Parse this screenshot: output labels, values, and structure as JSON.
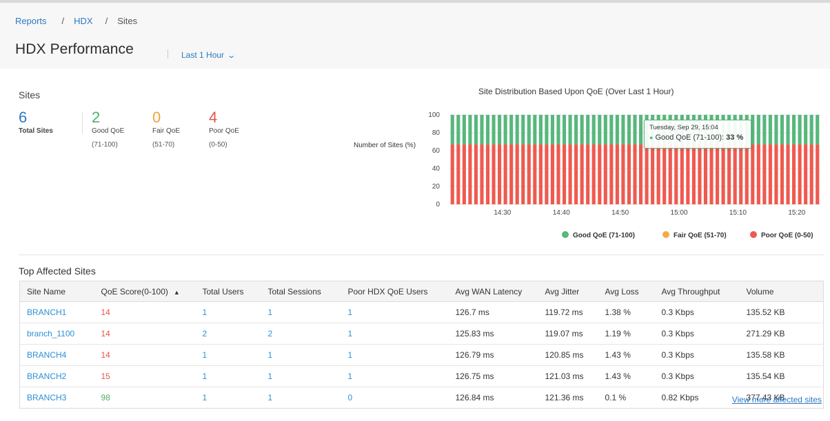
{
  "breadcrumb": {
    "items": [
      "Reports",
      "HDX",
      "Sites"
    ],
    "separator": "/"
  },
  "header": {
    "title": "HDX Performance",
    "time_range": "Last 1 Hour"
  },
  "sites": {
    "heading": "Sites",
    "total": {
      "value": "6",
      "label": "Total Sites",
      "color": "#2b79c1"
    },
    "good": {
      "value": "2",
      "label": "Good QoE",
      "range": "(71-100)",
      "color": "#4fae6b"
    },
    "fair": {
      "value": "0",
      "label": "Fair QoE",
      "range": "(51-70)",
      "color": "#f0a33a"
    },
    "poor": {
      "value": "4",
      "label": "Poor QoE",
      "range": "(0-50)",
      "color": "#e4544a"
    }
  },
  "chart_data": {
    "type": "bar",
    "stacked": true,
    "title": "Site Distribution Based Upon QoE (Over Last 1 Hour)",
    "ylabel": "Number of Sites (%)",
    "xlabel": "",
    "ylim": [
      0,
      100
    ],
    "yticks": [
      0,
      20,
      40,
      60,
      80,
      100
    ],
    "xtick_labels": [
      "14:30",
      "14:40",
      "14:50",
      "15:00",
      "15:10",
      "15:20"
    ],
    "x_range": [
      "14:21",
      "15:24"
    ],
    "series": [
      {
        "name": "Good QoE (71-100)",
        "color": "#58b77c",
        "value_each_interval": 33
      },
      {
        "name": "Fair QoE (51-70)",
        "color": "#f5ab44",
        "value_each_interval": 0
      },
      {
        "name": "Poor QoE (0-50)",
        "color": "#ef5a4f",
        "value_each_interval": 67
      }
    ],
    "legend": [
      "Good QoE (71-100)",
      "Fair QoE (51-70)",
      "Poor QoE (0-50)"
    ],
    "legend_position": "bottom-right",
    "grid": true,
    "tooltip": {
      "date": "Tuesday, Sep 29, 15:04",
      "series": "Good QoE (71-100):",
      "value": "33 %"
    }
  },
  "table": {
    "heading": "Top Affected Sites",
    "columns": [
      "Site Name",
      "QoE Score(0-100)",
      "Total Users",
      "Total Sessions",
      "Poor HDX QoE Users",
      "Avg WAN Latency",
      "Avg Jitter",
      "Avg Loss",
      "Avg Throughput",
      "Volume"
    ],
    "sort_indicator": "▲",
    "rows": [
      [
        "BRANCH1",
        "14",
        "1",
        "1",
        "1",
        "126.7 ms",
        "119.72 ms",
        "1.38 %",
        "0.3 Kbps",
        "135.52 KB"
      ],
      [
        "branch_1100",
        "14",
        "2",
        "2",
        "1",
        "125.83 ms",
        "119.07 ms",
        "1.19 %",
        "0.3 Kbps",
        "271.29 KB"
      ],
      [
        "BRANCH4",
        "14",
        "1",
        "1",
        "1",
        "126.79 ms",
        "120.85 ms",
        "1.43 %",
        "0.3 Kbps",
        "135.58 KB"
      ],
      [
        "BRANCH2",
        "15",
        "1",
        "1",
        "1",
        "126.75 ms",
        "121.03 ms",
        "1.43 %",
        "0.3 Kbps",
        "135.54 KB"
      ],
      [
        "BRANCH3",
        "98",
        "1",
        "1",
        "0",
        "126.84 ms",
        "121.36 ms",
        "0.1 %",
        "0.82 Kbps",
        "377.43 KB"
      ]
    ],
    "more_link": "View more affected sites"
  },
  "icons": {
    "time_range": "chevron-down-icon",
    "sort": "sort-ascending-icon"
  }
}
